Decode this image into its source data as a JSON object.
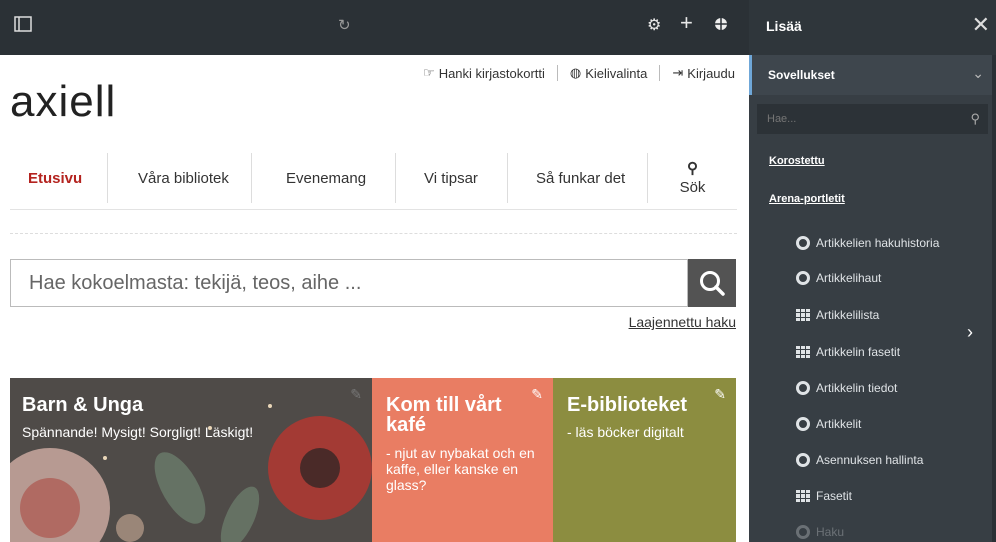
{
  "topbar": {
    "sidebar_icon": "sidebar-toggle-icon",
    "refresh_icon": "refresh-icon",
    "gear_icon": "gear-icon",
    "plus_label": "+",
    "target_icon": "crosshair-icon"
  },
  "header": {
    "logo": "axiell",
    "links": [
      {
        "label": "Hanki kirjastokortti",
        "icon": "hand-point-icon"
      },
      {
        "label": "Kielivalinta",
        "icon": "globe-icon"
      },
      {
        "label": "Kirjaudu",
        "icon": "sign-in-icon"
      }
    ]
  },
  "nav": {
    "items": [
      "Etusivu",
      "Våra bibliotek",
      "Evenemang",
      "Vi tipsar",
      "Så funkar det",
      "Sök"
    ]
  },
  "search": {
    "placeholder": "Hae kokoelmasta: tekijä, teos, aihe ...",
    "advanced_link": "Laajennettu haku"
  },
  "tiles": [
    {
      "title": "Barn & Unga",
      "subtitle": "Spännande! Mysigt! Sorgligt! Läskigt!",
      "color": "#4b4f52"
    },
    {
      "title": "Kom till vårt kafé",
      "subtitle": "- njut av nybakat och en kaffe, eller kanske en glass?",
      "color": "#e97d63"
    },
    {
      "title": "E-biblioteket",
      "subtitle": "- läs böcker digitalt",
      "color": "#8c8d40"
    }
  ],
  "sidebar": {
    "title": "Lisää",
    "section": "Sovellukset",
    "search_placeholder": "Hae...",
    "links": [
      "Korostettu",
      "Arena-portletit"
    ],
    "items": [
      {
        "label": "Artikkelien hakuhistoria",
        "icon": "circle"
      },
      {
        "label": "Artikkelihaut",
        "icon": "circle"
      },
      {
        "label": "Artikkelilista",
        "icon": "grid"
      },
      {
        "label": "Artikkelin fasetit",
        "icon": "grid"
      },
      {
        "label": "Artikkelin tiedot",
        "icon": "circle"
      },
      {
        "label": "Artikkelit",
        "icon": "circle"
      },
      {
        "label": "Asennuksen hallinta",
        "icon": "circle"
      },
      {
        "label": "Fasetit",
        "icon": "grid"
      },
      {
        "label": "Haku",
        "icon": "circle"
      }
    ]
  }
}
